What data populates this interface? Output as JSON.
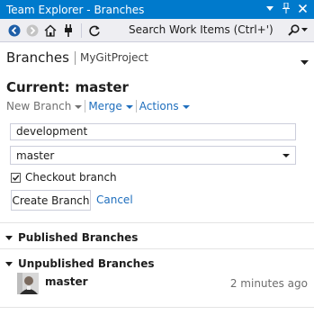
{
  "window": {
    "title": "Team Explorer - Branches"
  },
  "toolbar": {
    "search_placeholder": "Search Work Items (Ctrl+')"
  },
  "header": {
    "title": "Branches",
    "project": "MyGitProject"
  },
  "current": {
    "label": "Current:",
    "branch": "master"
  },
  "actions": {
    "new_branch": "New Branch",
    "merge": "Merge",
    "actions": "Actions"
  },
  "create_form": {
    "branch_name_value": "development",
    "base_branch_value": "master",
    "checkout_label": "Checkout branch",
    "checkout_checked": true,
    "create_button": "Create Branch",
    "cancel_link": "Cancel"
  },
  "sections": {
    "published": "Published Branches",
    "unpublished": "Unpublished Branches"
  },
  "unpublished_branches": [
    {
      "name": "master",
      "time": "2 minutes ago",
      "icon": "avatar"
    }
  ],
  "colors": {
    "title_bar": "#007acc",
    "toolbar": "#eeeef2",
    "link": "#1e6ebd"
  }
}
